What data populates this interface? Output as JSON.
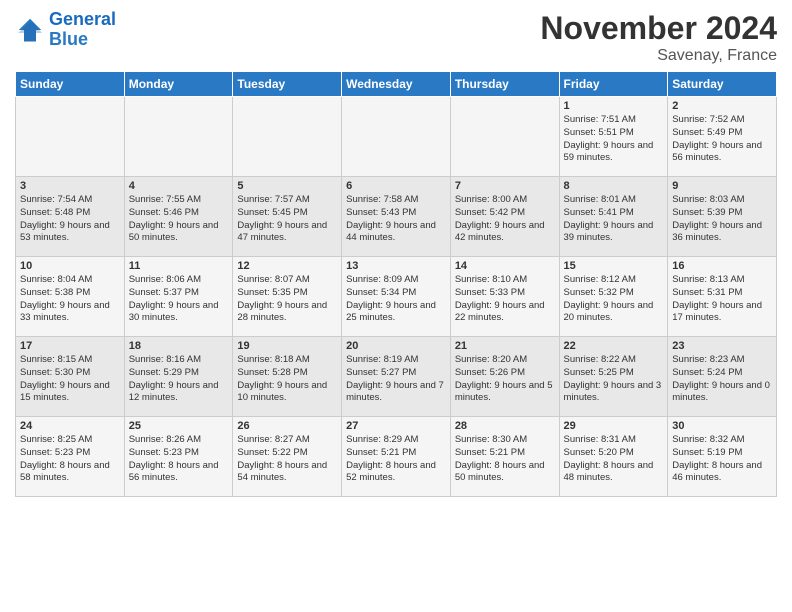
{
  "logo": {
    "line1": "General",
    "line2": "Blue"
  },
  "title": "November 2024",
  "subtitle": "Savenay, France",
  "days_of_week": [
    "Sunday",
    "Monday",
    "Tuesday",
    "Wednesday",
    "Thursday",
    "Friday",
    "Saturday"
  ],
  "weeks": [
    [
      {
        "day": "",
        "sunrise": "",
        "sunset": "",
        "daylight": ""
      },
      {
        "day": "",
        "sunrise": "",
        "sunset": "",
        "daylight": ""
      },
      {
        "day": "",
        "sunrise": "",
        "sunset": "",
        "daylight": ""
      },
      {
        "day": "",
        "sunrise": "",
        "sunset": "",
        "daylight": ""
      },
      {
        "day": "",
        "sunrise": "",
        "sunset": "",
        "daylight": ""
      },
      {
        "day": "1",
        "sunrise": "Sunrise: 7:51 AM",
        "sunset": "Sunset: 5:51 PM",
        "daylight": "Daylight: 9 hours and 59 minutes."
      },
      {
        "day": "2",
        "sunrise": "Sunrise: 7:52 AM",
        "sunset": "Sunset: 5:49 PM",
        "daylight": "Daylight: 9 hours and 56 minutes."
      }
    ],
    [
      {
        "day": "3",
        "sunrise": "Sunrise: 7:54 AM",
        "sunset": "Sunset: 5:48 PM",
        "daylight": "Daylight: 9 hours and 53 minutes."
      },
      {
        "day": "4",
        "sunrise": "Sunrise: 7:55 AM",
        "sunset": "Sunset: 5:46 PM",
        "daylight": "Daylight: 9 hours and 50 minutes."
      },
      {
        "day": "5",
        "sunrise": "Sunrise: 7:57 AM",
        "sunset": "Sunset: 5:45 PM",
        "daylight": "Daylight: 9 hours and 47 minutes."
      },
      {
        "day": "6",
        "sunrise": "Sunrise: 7:58 AM",
        "sunset": "Sunset: 5:43 PM",
        "daylight": "Daylight: 9 hours and 44 minutes."
      },
      {
        "day": "7",
        "sunrise": "Sunrise: 8:00 AM",
        "sunset": "Sunset: 5:42 PM",
        "daylight": "Daylight: 9 hours and 42 minutes."
      },
      {
        "day": "8",
        "sunrise": "Sunrise: 8:01 AM",
        "sunset": "Sunset: 5:41 PM",
        "daylight": "Daylight: 9 hours and 39 minutes."
      },
      {
        "day": "9",
        "sunrise": "Sunrise: 8:03 AM",
        "sunset": "Sunset: 5:39 PM",
        "daylight": "Daylight: 9 hours and 36 minutes."
      }
    ],
    [
      {
        "day": "10",
        "sunrise": "Sunrise: 8:04 AM",
        "sunset": "Sunset: 5:38 PM",
        "daylight": "Daylight: 9 hours and 33 minutes."
      },
      {
        "day": "11",
        "sunrise": "Sunrise: 8:06 AM",
        "sunset": "Sunset: 5:37 PM",
        "daylight": "Daylight: 9 hours and 30 minutes."
      },
      {
        "day": "12",
        "sunrise": "Sunrise: 8:07 AM",
        "sunset": "Sunset: 5:35 PM",
        "daylight": "Daylight: 9 hours and 28 minutes."
      },
      {
        "day": "13",
        "sunrise": "Sunrise: 8:09 AM",
        "sunset": "Sunset: 5:34 PM",
        "daylight": "Daylight: 9 hours and 25 minutes."
      },
      {
        "day": "14",
        "sunrise": "Sunrise: 8:10 AM",
        "sunset": "Sunset: 5:33 PM",
        "daylight": "Daylight: 9 hours and 22 minutes."
      },
      {
        "day": "15",
        "sunrise": "Sunrise: 8:12 AM",
        "sunset": "Sunset: 5:32 PM",
        "daylight": "Daylight: 9 hours and 20 minutes."
      },
      {
        "day": "16",
        "sunrise": "Sunrise: 8:13 AM",
        "sunset": "Sunset: 5:31 PM",
        "daylight": "Daylight: 9 hours and 17 minutes."
      }
    ],
    [
      {
        "day": "17",
        "sunrise": "Sunrise: 8:15 AM",
        "sunset": "Sunset: 5:30 PM",
        "daylight": "Daylight: 9 hours and 15 minutes."
      },
      {
        "day": "18",
        "sunrise": "Sunrise: 8:16 AM",
        "sunset": "Sunset: 5:29 PM",
        "daylight": "Daylight: 9 hours and 12 minutes."
      },
      {
        "day": "19",
        "sunrise": "Sunrise: 8:18 AM",
        "sunset": "Sunset: 5:28 PM",
        "daylight": "Daylight: 9 hours and 10 minutes."
      },
      {
        "day": "20",
        "sunrise": "Sunrise: 8:19 AM",
        "sunset": "Sunset: 5:27 PM",
        "daylight": "Daylight: 9 hours and 7 minutes."
      },
      {
        "day": "21",
        "sunrise": "Sunrise: 8:20 AM",
        "sunset": "Sunset: 5:26 PM",
        "daylight": "Daylight: 9 hours and 5 minutes."
      },
      {
        "day": "22",
        "sunrise": "Sunrise: 8:22 AM",
        "sunset": "Sunset: 5:25 PM",
        "daylight": "Daylight: 9 hours and 3 minutes."
      },
      {
        "day": "23",
        "sunrise": "Sunrise: 8:23 AM",
        "sunset": "Sunset: 5:24 PM",
        "daylight": "Daylight: 9 hours and 0 minutes."
      }
    ],
    [
      {
        "day": "24",
        "sunrise": "Sunrise: 8:25 AM",
        "sunset": "Sunset: 5:23 PM",
        "daylight": "Daylight: 8 hours and 58 minutes."
      },
      {
        "day": "25",
        "sunrise": "Sunrise: 8:26 AM",
        "sunset": "Sunset: 5:23 PM",
        "daylight": "Daylight: 8 hours and 56 minutes."
      },
      {
        "day": "26",
        "sunrise": "Sunrise: 8:27 AM",
        "sunset": "Sunset: 5:22 PM",
        "daylight": "Daylight: 8 hours and 54 minutes."
      },
      {
        "day": "27",
        "sunrise": "Sunrise: 8:29 AM",
        "sunset": "Sunset: 5:21 PM",
        "daylight": "Daylight: 8 hours and 52 minutes."
      },
      {
        "day": "28",
        "sunrise": "Sunrise: 8:30 AM",
        "sunset": "Sunset: 5:21 PM",
        "daylight": "Daylight: 8 hours and 50 minutes."
      },
      {
        "day": "29",
        "sunrise": "Sunrise: 8:31 AM",
        "sunset": "Sunset: 5:20 PM",
        "daylight": "Daylight: 8 hours and 48 minutes."
      },
      {
        "day": "30",
        "sunrise": "Sunrise: 8:32 AM",
        "sunset": "Sunset: 5:19 PM",
        "daylight": "Daylight: 8 hours and 46 minutes."
      }
    ]
  ]
}
